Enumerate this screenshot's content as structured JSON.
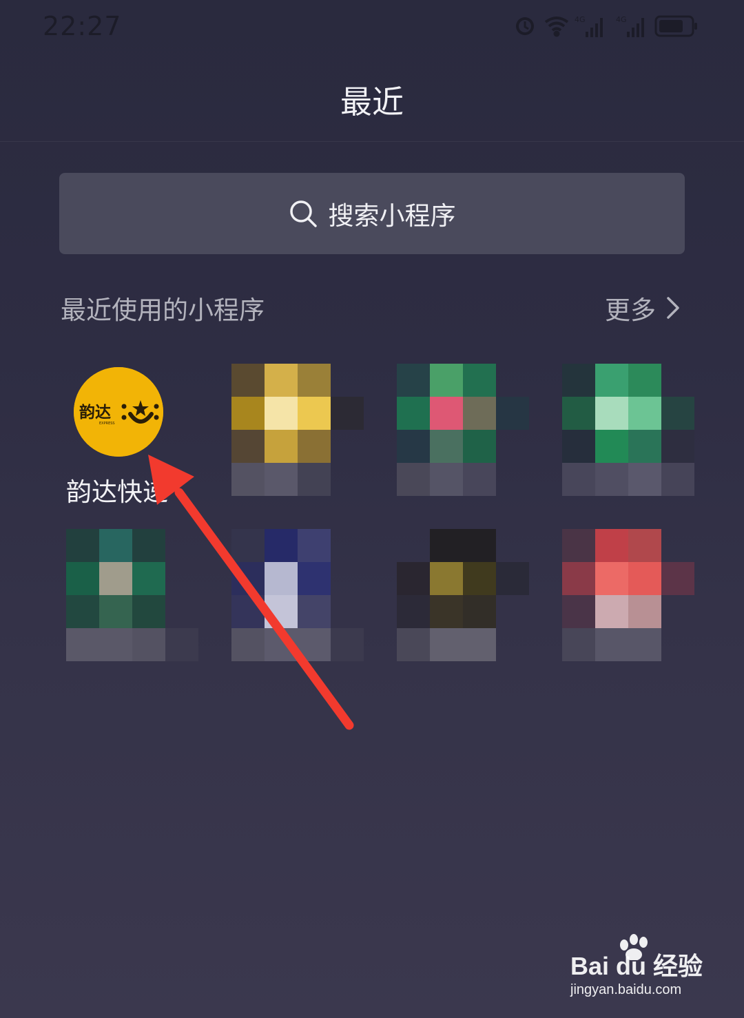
{
  "status_bar": {
    "time": "22:27",
    "network_1": "4G",
    "network_2": "4G",
    "icons": [
      "alarm-icon",
      "wifi-icon",
      "signal-icon",
      "signal-icon",
      "battery-icon"
    ]
  },
  "header": {
    "title": "最近"
  },
  "search": {
    "placeholder": "搜索小程序",
    "icon": "search-icon"
  },
  "recent_section": {
    "title": "最近使用的小程序",
    "more_label": "更多",
    "more_icon": "chevron-right-icon"
  },
  "apps": [
    {
      "label": "韵达快递",
      "logo_text": "韵达",
      "logo_sub": "EXPRESS",
      "logo_color": "#f2b406",
      "pixelated": false
    },
    {
      "label": "",
      "pixelated": true
    },
    {
      "label": "",
      "pixelated": true
    },
    {
      "label": "",
      "pixelated": true
    },
    {
      "label": "",
      "pixelated": true
    },
    {
      "label": "",
      "pixelated": true
    },
    {
      "label": "",
      "pixelated": true
    },
    {
      "label": "",
      "pixelated": true
    }
  ],
  "annotation": {
    "arrow_color": "#f23a2e",
    "arrow_target": "韵达快递"
  },
  "watermark": {
    "brand": "Bai du 经验",
    "url": "jingyan.baidu.com"
  }
}
